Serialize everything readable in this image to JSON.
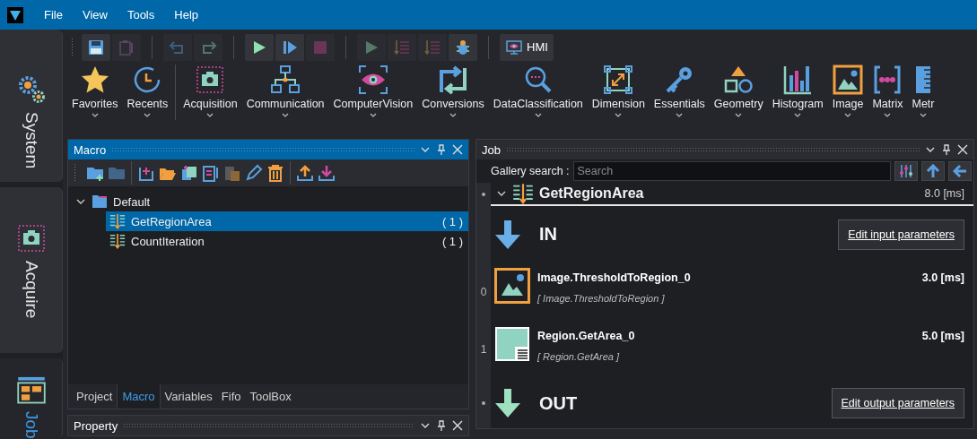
{
  "menu": [
    "File",
    "View",
    "Tools",
    "Help"
  ],
  "side_tabs": [
    {
      "label": "System",
      "kind": "gears",
      "selected": false
    },
    {
      "label": "Acquire",
      "kind": "camera",
      "selected": false
    },
    {
      "label": "Job",
      "kind": "layout",
      "selected": true
    }
  ],
  "toolbar": [
    {
      "kind": "save",
      "disabled": false
    },
    {
      "kind": "clipboard",
      "disabled": true
    },
    {
      "kind": "sep"
    },
    {
      "kind": "undo",
      "disabled": true
    },
    {
      "kind": "redo",
      "disabled": true
    },
    {
      "kind": "sep"
    },
    {
      "kind": "run",
      "disabled": false
    },
    {
      "kind": "step",
      "disabled": false
    },
    {
      "kind": "stop",
      "disabled": true
    },
    {
      "kind": "sep"
    },
    {
      "kind": "run",
      "disabled": true
    },
    {
      "kind": "list",
      "disabled": true
    },
    {
      "kind": "list",
      "disabled": true
    },
    {
      "kind": "bug",
      "disabled": false
    },
    {
      "kind": "sep"
    },
    {
      "kind": "hmi",
      "label": "HMI",
      "disabled": false
    }
  ],
  "ribbon": [
    {
      "label": "Favorites",
      "kind": "star"
    },
    {
      "label": "Recents",
      "kind": "clock"
    },
    {
      "kind": "sep"
    },
    {
      "label": "Acquisition",
      "kind": "camera"
    },
    {
      "label": "Communication",
      "kind": "network"
    },
    {
      "label": "ComputerVision",
      "kind": "eye"
    },
    {
      "label": "Conversions",
      "kind": "convert"
    },
    {
      "label": "DataClassification",
      "kind": "magnifier"
    },
    {
      "label": "Dimension",
      "kind": "resize"
    },
    {
      "label": "Essentials",
      "kind": "key"
    },
    {
      "label": "Geometry",
      "kind": "shapes"
    },
    {
      "label": "Histogram",
      "kind": "histogram"
    },
    {
      "label": "Image",
      "kind": "image"
    },
    {
      "label": "Matrix",
      "kind": "matrix"
    },
    {
      "label": "Metr",
      "kind": "ruler"
    }
  ],
  "macro_panel": {
    "title": "Macro",
    "active": true,
    "tree": [
      {
        "label": "Default",
        "expanded": true,
        "selected": false,
        "children": [
          {
            "label": "GetRegionArea",
            "count": "( 1 )",
            "selected": true
          },
          {
            "label": "CountIteration",
            "count": "( 1 )",
            "selected": false
          }
        ]
      }
    ],
    "tabs": [
      {
        "label": "Project",
        "selected": false
      },
      {
        "label": "Macro",
        "selected": true
      },
      {
        "label": "Variables",
        "selected": false
      },
      {
        "label": "Fifo",
        "selected": false
      },
      {
        "label": "ToolBox",
        "selected": false
      }
    ]
  },
  "property_panel": {
    "title": "Property"
  },
  "job_panel": {
    "title": "Job",
    "active": false,
    "search_label": "Gallery search :",
    "search": {
      "placeholder": "Search"
    },
    "macro": {
      "name": "GetRegionArea",
      "time": "8.0 [ms]"
    },
    "in": {
      "label": "IN",
      "button": "Edit input parameters"
    },
    "steps": [
      {
        "index": "0",
        "name": "Image.ThresholdToRegion_0",
        "type": "[ Image.ThresholdToRegion ]",
        "time": "3.0 [ms]",
        "kind": "image"
      },
      {
        "index": "1",
        "name": "Region.GetArea_0",
        "type": "[ Region.GetArea ]",
        "time": "5.0 [ms]",
        "kind": "region"
      }
    ],
    "out": {
      "label": "OUT",
      "button": "Edit output parameters"
    }
  }
}
